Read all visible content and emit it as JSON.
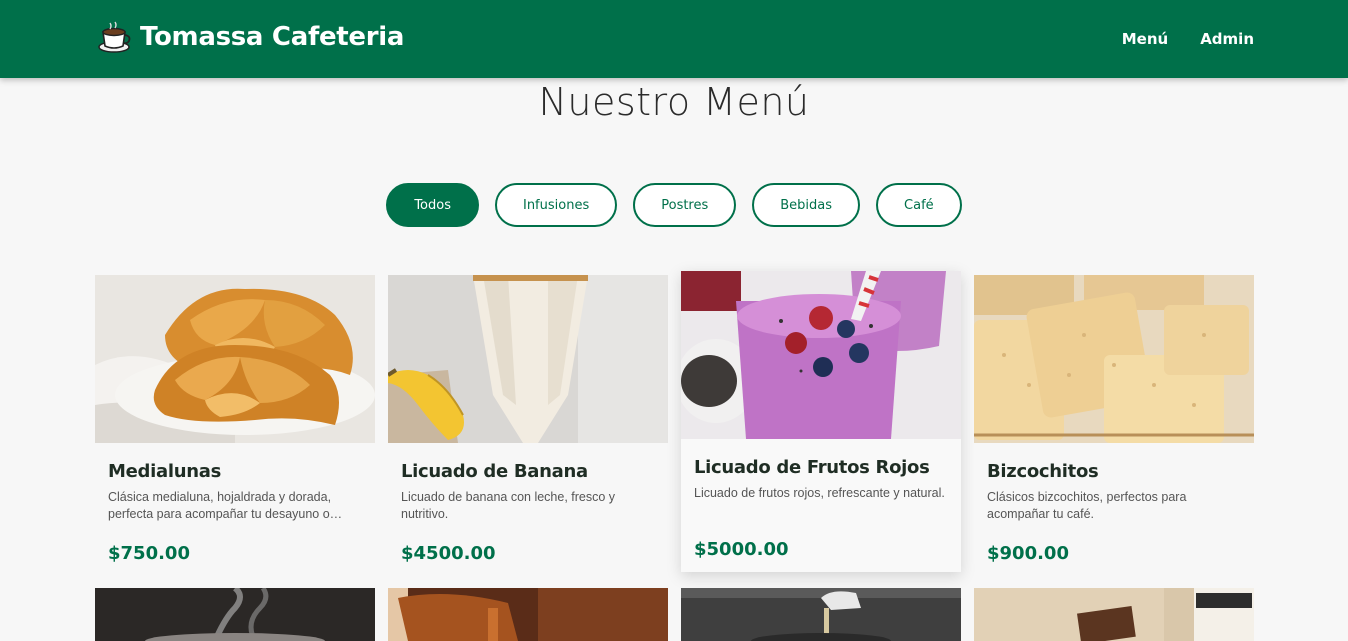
{
  "brand": {
    "name": "Tomassa Cafeteria",
    "icon": "coffee-cup-icon"
  },
  "nav": {
    "menu": "Menú",
    "admin": "Admin"
  },
  "page": {
    "title": "Nuestro Menú"
  },
  "filters": [
    "Todos",
    "Infusiones",
    "Postres",
    "Bebidas",
    "Café"
  ],
  "colors": {
    "primary": "#00704a",
    "background": "#f7f7f7"
  },
  "products": [
    {
      "name": "Medialunas",
      "description": "Clásica medialuna, hojaldrada y dorada, perfecta para acompañar tu desayuno o…",
      "price": "$750.00"
    },
    {
      "name": "Licuado de Banana",
      "description": "Licuado de banana con leche, fresco y nutritivo.",
      "price": "$4500.00"
    },
    {
      "name": "Licuado de Frutos Rojos",
      "description": "Licuado de frutos rojos, refrescante y natural.",
      "price": "$5000.00"
    },
    {
      "name": "Bizcochitos",
      "description": "Clásicos bizcochitos, perfectos para acompañar tu café.",
      "price": "$900.00"
    }
  ]
}
